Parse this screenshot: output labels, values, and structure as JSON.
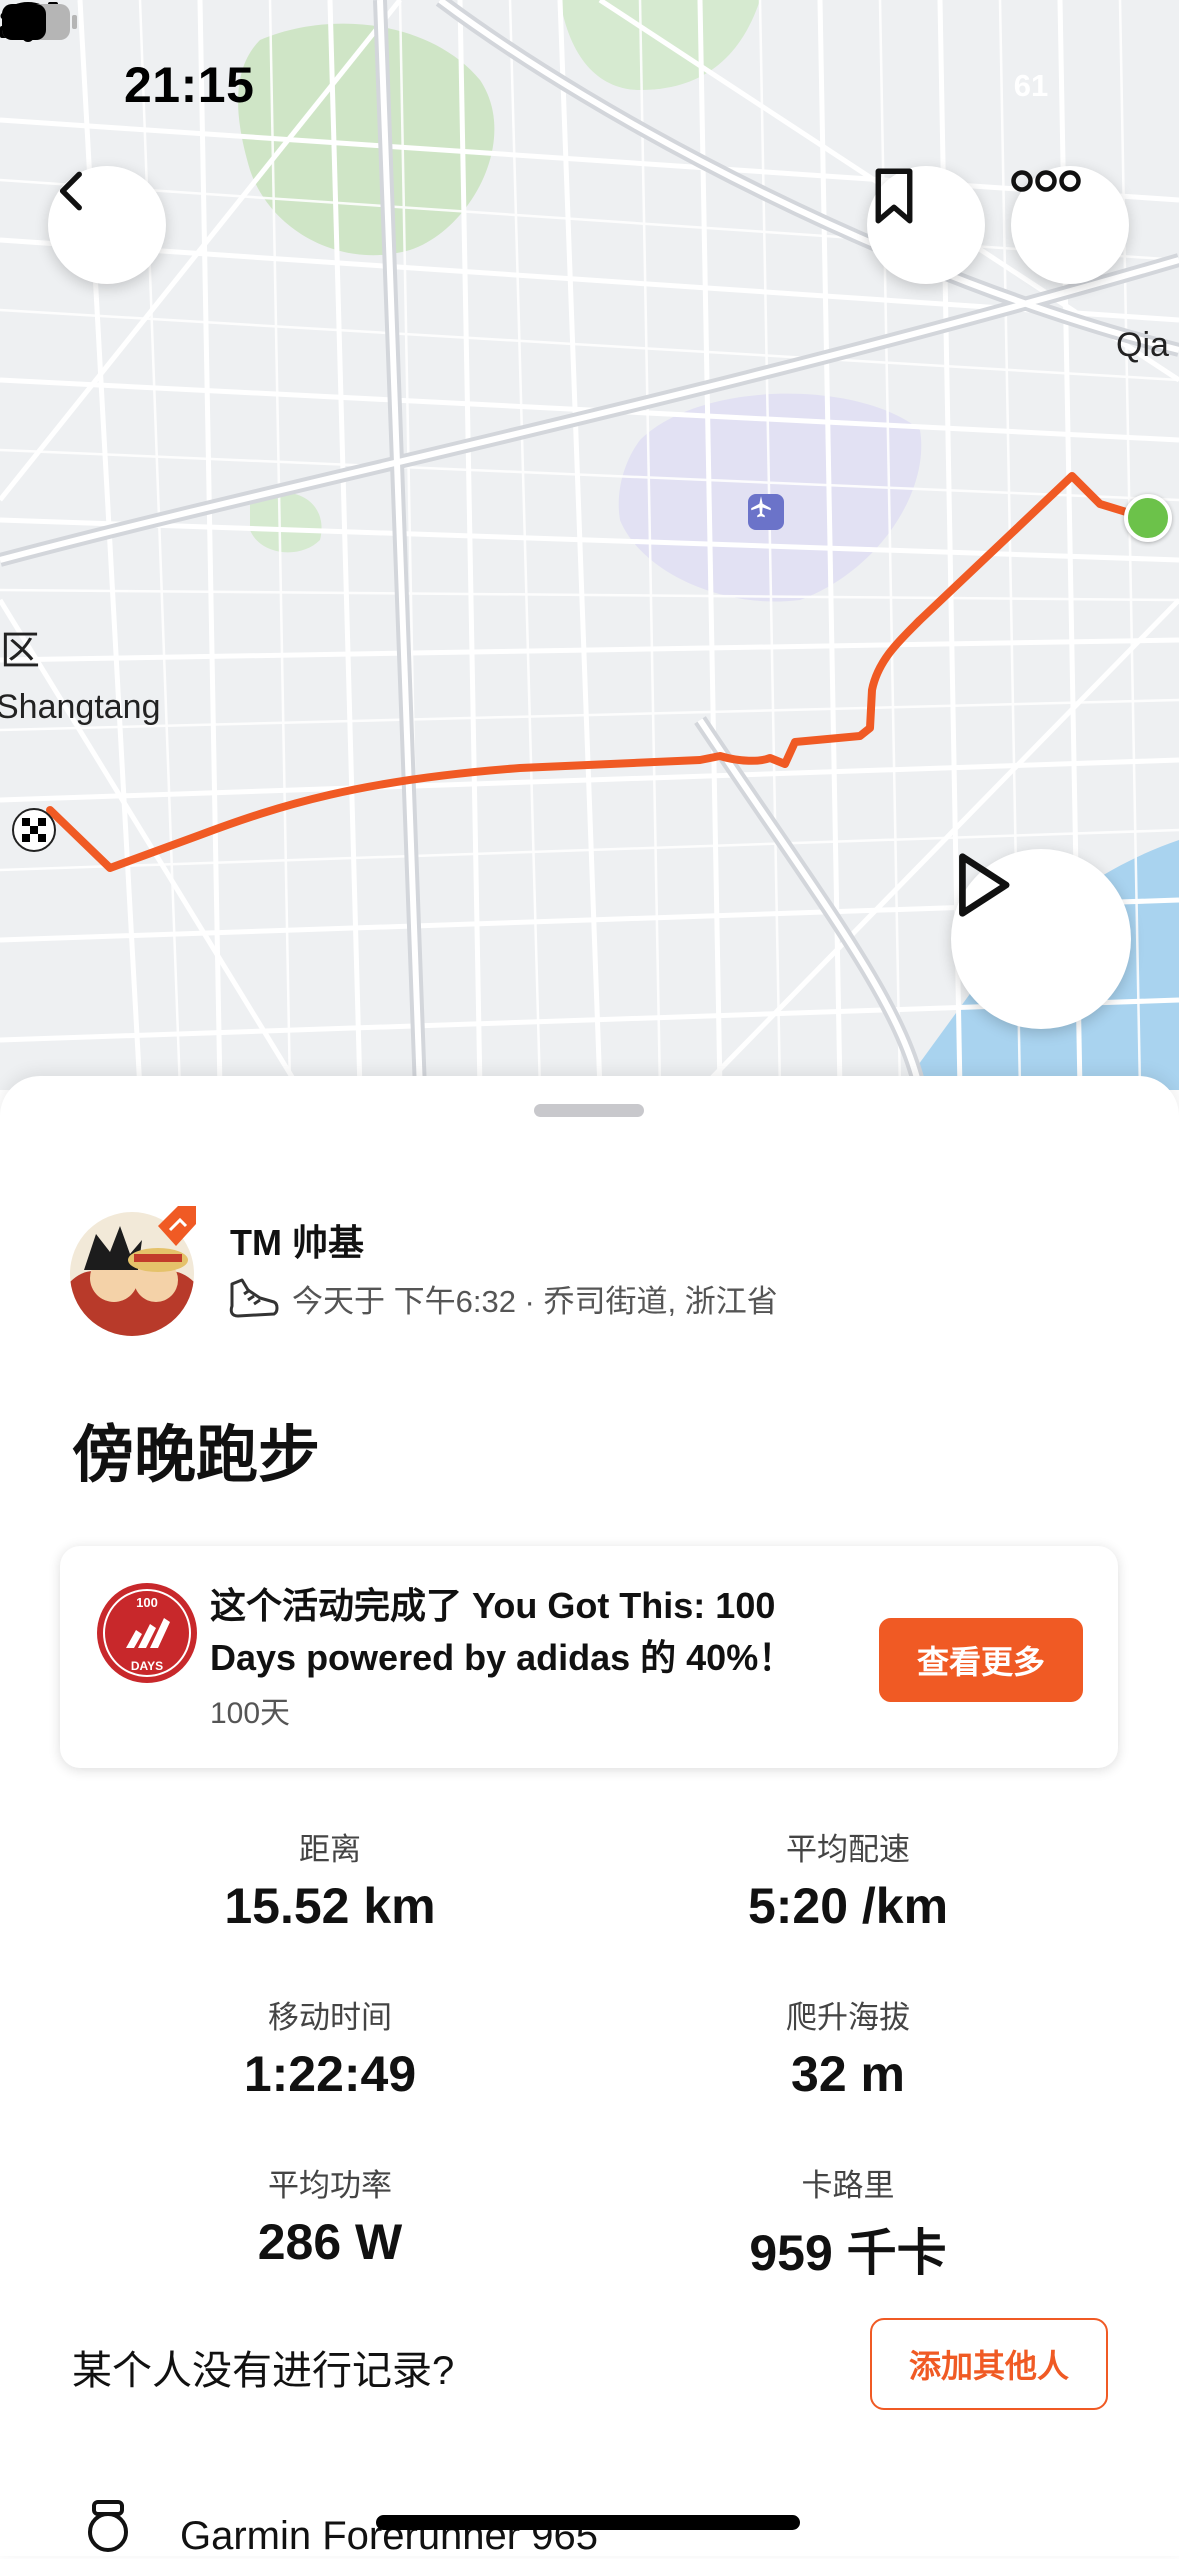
{
  "status_bar": {
    "time": "21:15",
    "battery_level": "61"
  },
  "map": {
    "labels": {
      "district": "区",
      "place_left": "Shangtang",
      "place_right": "Qia"
    },
    "route_color": "#f05a24",
    "start_marker_color": "#6cc24a"
  },
  "icons": {
    "back": "chevron-left-icon",
    "bookmark": "bookmark-icon",
    "more": "more-dots-icon",
    "play": "play-icon",
    "airport": "airport-icon",
    "finish": "checkered-flag-icon",
    "shoe": "running-shoe-icon",
    "watch": "watch-icon"
  },
  "athlete": {
    "name": "TM 帅基"
  },
  "activity": {
    "meta": "今天于 下午6:32 · 乔司街道, 浙江省",
    "title": "傍晚跑步"
  },
  "challenge": {
    "text": "这个活动完成了 You Got This: 100 Days powered by adidas 的 40%！",
    "sub": "100天",
    "logo_top": "100",
    "logo_bottom": "DAYS",
    "button": "查看更多",
    "accent": "#f05a24"
  },
  "stats": [
    {
      "label": "距离",
      "value": "15.52 km"
    },
    {
      "label": "平均配速",
      "value": "5:20 /km"
    },
    {
      "label": "移动时间",
      "value": "1:22:49"
    },
    {
      "label": "爬升海拔",
      "value": "32 m"
    },
    {
      "label": "平均功率",
      "value": "286 W"
    },
    {
      "label": "卡路里",
      "value": "959 千卡"
    }
  ],
  "others": {
    "question": "某个人没有进行记录?",
    "button": "添加其他人"
  },
  "device": {
    "name": "Garmin Forerunner 965"
  }
}
